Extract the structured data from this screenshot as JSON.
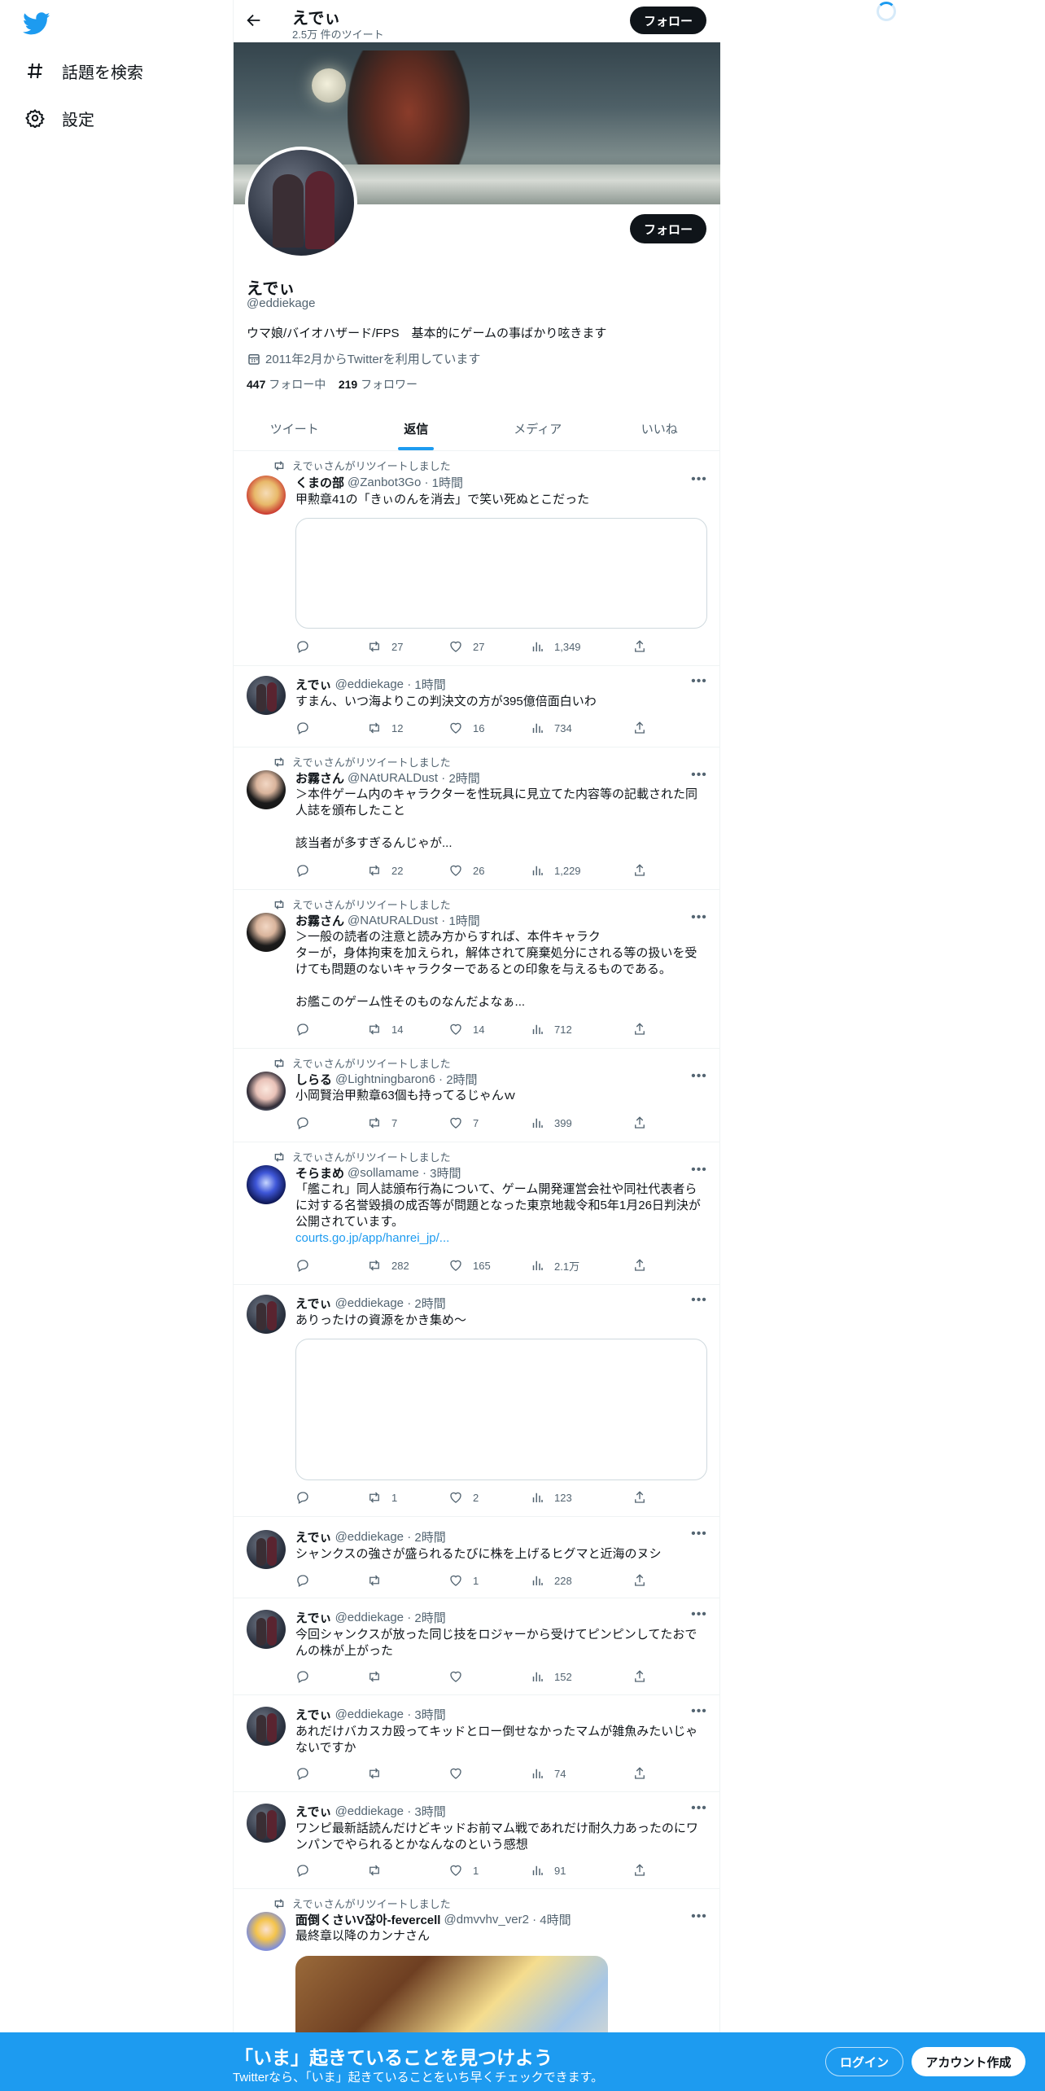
{
  "nav": {
    "explore_label": "話題を検索",
    "settings_label": "設定"
  },
  "topbar": {
    "name": "えでぃ",
    "tweet_count": "2.5万 件のツイート",
    "follow_label": "フォロー"
  },
  "profile": {
    "name": "えでぃ",
    "handle": "@eddiekage",
    "bio": "ウマ娘/バイオハザード/FPS　基本的にゲームの事ばかり呟きます",
    "joined": "2011年2月からTwitterを利用しています",
    "following_count": "447",
    "following_label": "フォロー中",
    "followers_count": "219",
    "followers_label": "フォロワー",
    "follow_label": "フォロー"
  },
  "tabs": [
    {
      "label": "ツイート",
      "active": false
    },
    {
      "label": "返信",
      "active": true
    },
    {
      "label": "メディア",
      "active": false
    },
    {
      "label": "いいね",
      "active": false
    }
  ],
  "colors": {
    "accent": "#1d9bf0",
    "text": "#0f1419",
    "secondary": "#536471",
    "dark_button": "#0f1419"
  },
  "tweets": [
    {
      "retweeted_by": "えでぃさんがリツイートしました",
      "name": "くまの部",
      "handle": "@Zanbot3Go",
      "time": "1時間",
      "lines": [
        "甲勲章41の「きぃのんを消去」で笑い死ぬとこだった"
      ],
      "replies": "",
      "retweets": "27",
      "likes": "27",
      "views": "1,349"
    },
    {
      "retweeted_by": "",
      "name": "えでぃ",
      "handle": "@eddiekage",
      "time": "1時間",
      "lines": [
        "すまん、いつ海よりこの判決文の方が395億倍面白いわ"
      ],
      "replies": "",
      "retweets": "12",
      "likes": "16",
      "views": "734"
    },
    {
      "retweeted_by": "えでぃさんがリツイートしました",
      "name": "お霧さん",
      "handle": "@NAtURALDust",
      "time": "2時間",
      "lines": [
        "＞本件ゲーム内のキャラクターを性玩具に見立てた内容等の記載された同",
        "人誌を頒布したこと",
        "",
        "該当者が多すぎるんじゃが..."
      ],
      "replies": "",
      "retweets": "22",
      "likes": "26",
      "views": "1,229"
    },
    {
      "retweeted_by": "えでぃさんがリツイートしました",
      "name": "お霧さん",
      "handle": "@NAtURALDust",
      "time": "1時間",
      "lines": [
        "＞一般の読者の注意と読み方からすれば、本件キャラク",
        "ターが，身体拘束を加えられ，解体されて廃棄処分にされる等の扱いを受",
        "けても問題のないキャラクターであるとの印象を与えるものである。",
        "",
        "お艦このゲーム性そのものなんだよなぁ..."
      ],
      "replies": "",
      "retweets": "14",
      "likes": "14",
      "views": "712"
    },
    {
      "retweeted_by": "えでぃさんがリツイートしました",
      "name": "しらる",
      "handle": "@Lightningbaron6",
      "time": "2時間",
      "lines": [
        "小岡賢治甲勲章63個も持ってるじゃんｗ"
      ],
      "replies": "",
      "retweets": "7",
      "likes": "7",
      "views": "399"
    },
    {
      "retweeted_by": "えでぃさんがリツイートしました",
      "name": "そらまめ",
      "handle": "@sollamame",
      "time": "3時間",
      "lines": [
        "「艦これ」同人誌頒布行為について、ゲーム開発運営会社や同社代表者ら",
        "に対する名誉毀損の成否等が問題となった東京地裁令和5年1月26日判決が",
        "公開されています。"
      ],
      "link": "courts.go.jp/app/hanrei_jp/...",
      "replies": "",
      "retweets": "282",
      "likes": "165",
      "views": "2.1万"
    },
    {
      "retweeted_by": "",
      "name": "えでぃ",
      "handle": "@eddiekage",
      "time": "2時間",
      "lines": [
        "ありったけの資源をかき集め～"
      ],
      "replies": "",
      "retweets": "1",
      "likes": "2",
      "views": "123"
    },
    {
      "retweeted_by": "",
      "name": "えでぃ",
      "handle": "@eddiekage",
      "time": "2時間",
      "lines": [
        "シャンクスの強さが盛られるたびに株を上げるヒグマと近海のヌシ"
      ],
      "replies": "",
      "retweets": "",
      "likes": "1",
      "views": "228"
    },
    {
      "retweeted_by": "",
      "name": "えでぃ",
      "handle": "@eddiekage",
      "time": "2時間",
      "lines": [
        "今回シャンクスが放った同じ技をロジャーから受けてピンピンしてたおで",
        "んの株が上がった"
      ],
      "replies": "",
      "retweets": "",
      "likes": "",
      "views": "152"
    },
    {
      "retweeted_by": "",
      "name": "えでぃ",
      "handle": "@eddiekage",
      "time": "3時間",
      "lines": [
        "あれだけバカスカ殴ってキッドとロー倒せなかったマムが雑魚みたいじゃ",
        "ないですか"
      ],
      "replies": "",
      "retweets": "",
      "likes": "",
      "views": "74"
    },
    {
      "retweeted_by": "",
      "name": "えでぃ",
      "handle": "@eddiekage",
      "time": "3時間",
      "lines": [
        "ワンピ最新話読んだけどキッドお前マム戦であれだけ耐久力あったのにワ",
        "ンパンでやられるとかなんなのという感想"
      ],
      "replies": "",
      "retweets": "",
      "likes": "1",
      "views": "91"
    },
    {
      "retweeted_by": "えでぃさんがリツイートしました",
      "name": "面倒くさいV잖아-fevercell",
      "handle": "@dmvvhv_ver2",
      "time": "4時間",
      "lines": [
        "最終章以降のカンナさん"
      ]
    }
  ],
  "bottom": {
    "title": "「いま」起きていることを見つけよう",
    "subtitle": "Twitterなら、「いま」起きていることをいち早くチェックできます。",
    "login_label": "ログイン",
    "signup_label": "アカウント作成"
  }
}
